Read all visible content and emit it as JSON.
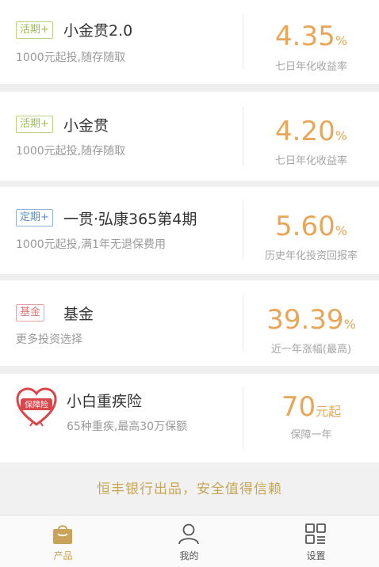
{
  "products": [
    {
      "tag": "活期+",
      "tag_type": "live",
      "title": "小金贯2.0",
      "subtitle": "1000元起投,随存随取",
      "rate": "4.35",
      "rate_unit": "%",
      "rate_label": "七日年化收益率"
    },
    {
      "tag": "活期+",
      "tag_type": "live",
      "title": "小金贯",
      "subtitle": "1000元起投,随存随取",
      "rate": "4.20",
      "rate_unit": "%",
      "rate_label": "七日年化收益率"
    },
    {
      "tag": "定期+",
      "tag_type": "fixed",
      "title": "一贯·弘康365第4期",
      "subtitle": "1000元起投,满1年无退保费用",
      "rate": "5.60",
      "rate_unit": "%",
      "rate_label": "历史年化投资回报率"
    },
    {
      "tag": "基金",
      "tag_type": "fund",
      "title": "基金",
      "subtitle": "更多投资选择",
      "rate": "39.39",
      "rate_unit": "%",
      "rate_label": "近一年涨幅(最高)"
    }
  ],
  "insurance": {
    "badge": "保障险",
    "title": "小白重疾险",
    "subtitle": "65种重疾,最高30万保额",
    "price": "70",
    "price_unit": "元起",
    "price_label": "保障一年"
  },
  "slogan": "恒丰银行出品，安全值得信赖",
  "tabs": [
    {
      "label": "产品",
      "icon": "bag-icon",
      "active": true
    },
    {
      "label": "我的",
      "icon": "user-icon",
      "active": false
    },
    {
      "label": "设置",
      "icon": "grid-icon",
      "active": false
    }
  ],
  "colors": {
    "accent": "#e8a659",
    "gold": "#c6a657",
    "live_tag": "#9dbd55",
    "fixed_tag": "#5c8fc7",
    "fund_tag": "#d9797a",
    "insurance_red": "#d9474b"
  }
}
